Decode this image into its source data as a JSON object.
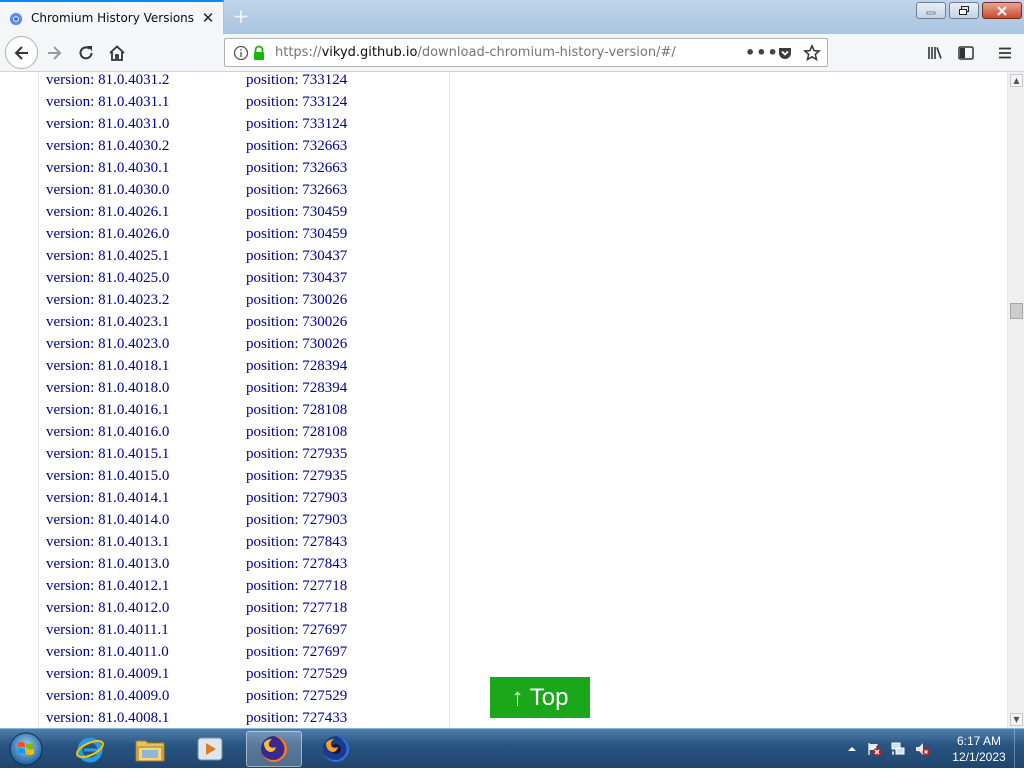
{
  "browser": {
    "tab_title": "Chromium History Versions Do",
    "new_tab_symbol": "+",
    "tab_close_symbol": "✕",
    "url_prefix": "https://",
    "url_domain": "vikyd.github.io",
    "url_path": "/download-chromium-history-version/#/",
    "url_more": "•••"
  },
  "versions": [
    {
      "version": "version: 81.0.4031.2",
      "position": "position: 733124"
    },
    {
      "version": "version: 81.0.4031.1",
      "position": "position: 733124"
    },
    {
      "version": "version: 81.0.4031.0",
      "position": "position: 733124"
    },
    {
      "version": "version: 81.0.4030.2",
      "position": "position: 732663"
    },
    {
      "version": "version: 81.0.4030.1",
      "position": "position: 732663"
    },
    {
      "version": "version: 81.0.4030.0",
      "position": "position: 732663"
    },
    {
      "version": "version: 81.0.4026.1",
      "position": "position: 730459"
    },
    {
      "version": "version: 81.0.4026.0",
      "position": "position: 730459"
    },
    {
      "version": "version: 81.0.4025.1",
      "position": "position: 730437"
    },
    {
      "version": "version: 81.0.4025.0",
      "position": "position: 730437"
    },
    {
      "version": "version: 81.0.4023.2",
      "position": "position: 730026"
    },
    {
      "version": "version: 81.0.4023.1",
      "position": "position: 730026"
    },
    {
      "version": "version: 81.0.4023.0",
      "position": "position: 730026"
    },
    {
      "version": "version: 81.0.4018.1",
      "position": "position: 728394"
    },
    {
      "version": "version: 81.0.4018.0",
      "position": "position: 728394"
    },
    {
      "version": "version: 81.0.4016.1",
      "position": "position: 728108"
    },
    {
      "version": "version: 81.0.4016.0",
      "position": "position: 728108"
    },
    {
      "version": "version: 81.0.4015.1",
      "position": "position: 727935"
    },
    {
      "version": "version: 81.0.4015.0",
      "position": "position: 727935"
    },
    {
      "version": "version: 81.0.4014.1",
      "position": "position: 727903"
    },
    {
      "version": "version: 81.0.4014.0",
      "position": "position: 727903"
    },
    {
      "version": "version: 81.0.4013.1",
      "position": "position: 727843"
    },
    {
      "version": "version: 81.0.4013.0",
      "position": "position: 727843"
    },
    {
      "version": "version: 81.0.4012.1",
      "position": "position: 727718"
    },
    {
      "version": "version: 81.0.4012.0",
      "position": "position: 727718"
    },
    {
      "version": "version: 81.0.4011.1",
      "position": "position: 727697"
    },
    {
      "version": "version: 81.0.4011.0",
      "position": "position: 727697"
    },
    {
      "version": "version: 81.0.4009.1",
      "position": "position: 727529"
    },
    {
      "version": "version: 81.0.4009.0",
      "position": "position: 727529"
    },
    {
      "version": "version: 81.0.4008.1",
      "position": "position: 727433"
    }
  ],
  "top_button_label": "↑ Top",
  "taskbar": {
    "time": "6:17 AM",
    "date": "12/1/2023"
  },
  "colors": {
    "link_text": "#00008b",
    "top_button": "#1aa81a",
    "accent_tab": "#0a84ff"
  },
  "icons": {
    "tab": "chromium-favicon-icon",
    "nav": [
      "back-arrow-icon",
      "forward-arrow-icon",
      "reload-icon",
      "home-icon"
    ],
    "url": [
      "info-icon",
      "lock-icon",
      "pocket-icon",
      "star-bookmark-icon"
    ],
    "toolbar": [
      "library-icon",
      "sidebar-icon",
      "hamburger-menu-icon"
    ],
    "taskbar": [
      "windows-start-icon",
      "internet-explorer-icon",
      "file-explorer-icon",
      "media-player-icon",
      "firefox-icon",
      "firefox-nightly-icon"
    ],
    "tray": [
      "tray-arrow-icon",
      "action-center-icon",
      "network-icon",
      "volume-muted-icon"
    ]
  }
}
